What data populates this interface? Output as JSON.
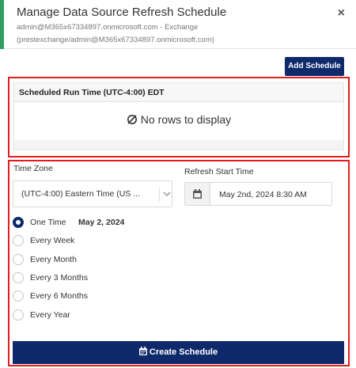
{
  "dialog": {
    "title": "Manage Data Source Refresh Schedule",
    "subtitle_line1": "admin@M365x67334897.onmicrosoft.com - Exchange",
    "subtitle_line2": "(prestexchange/admin@M365x67334897.onmicrosoft.com)",
    "close_label": "×"
  },
  "toolbar": {
    "add_schedule_label": "Add Schedule"
  },
  "grid": {
    "column_header": "Scheduled Run Time (UTC-4:00) EDT",
    "empty_message": "No rows to display"
  },
  "form": {
    "time_zone_label": "Time Zone",
    "time_zone_value": "(UTC-4:00) Eastern Time (US ...",
    "refresh_start_label": "Refresh Start Time",
    "refresh_start_value": "May 2nd, 2024 8:30 AM",
    "frequency_options": [
      {
        "label": "One Time",
        "selected": true,
        "date": "May 2, 2024"
      },
      {
        "label": "Every Week",
        "selected": false
      },
      {
        "label": "Every Month",
        "selected": false
      },
      {
        "label": "Every 3 Months",
        "selected": false
      },
      {
        "label": "Every 6 Months",
        "selected": false
      },
      {
        "label": "Every Year",
        "selected": false
      }
    ],
    "create_label": "Create Schedule"
  },
  "colors": {
    "accent_green": "#2e9e62",
    "primary_navy": "#0e2a6b",
    "highlight_red": "#e21d1d"
  }
}
